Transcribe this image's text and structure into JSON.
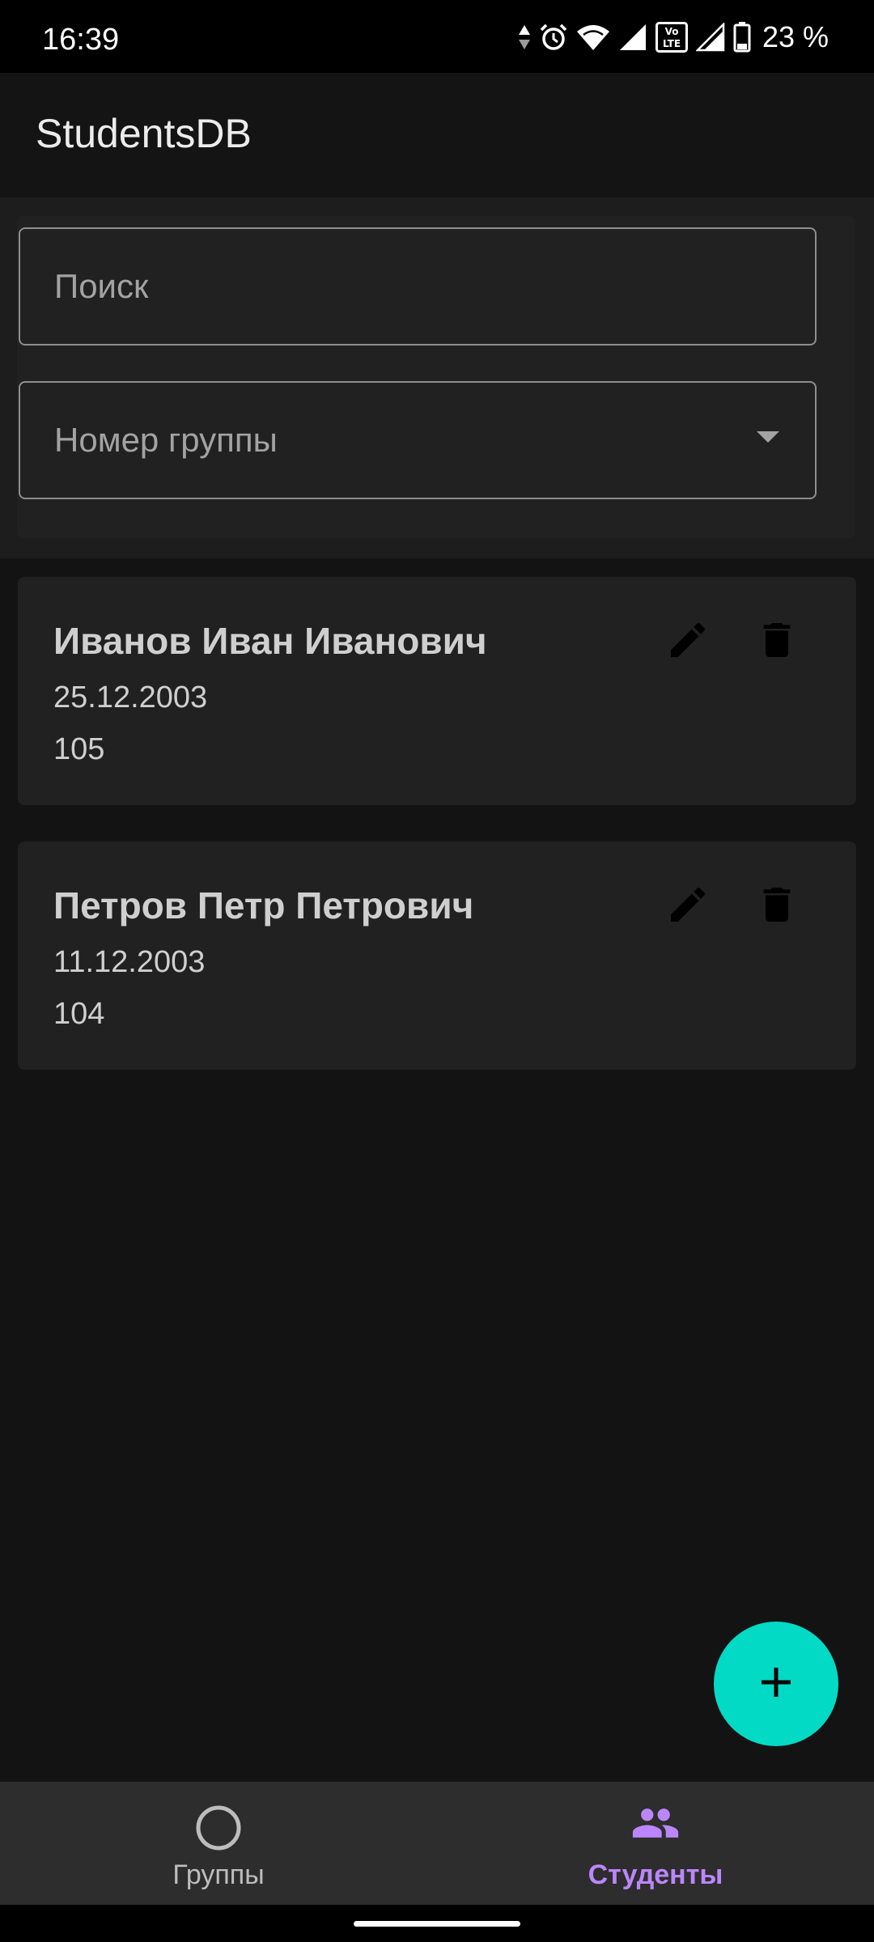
{
  "status_bar": {
    "time": "16:39",
    "battery": "23 %",
    "icons": [
      "data-arrows-icon",
      "alarm-icon",
      "wifi-icon",
      "volte-icon",
      "signal-icon",
      "battery-icon"
    ]
  },
  "app_bar": {
    "title": "StudentsDB"
  },
  "filters": {
    "search_placeholder": "Поиск",
    "group_label": "Номер группы",
    "group_icon": "dropdown-arrow-icon"
  },
  "students": [
    {
      "name": "Иванов Иван Иванович",
      "birth_date": "25.12.2003",
      "group": "105"
    },
    {
      "name": "Петров Петр Петрович",
      "birth_date": "11.12.2003",
      "group": "104"
    }
  ],
  "fab": {
    "icon": "add-icon",
    "color": "#03dac5"
  },
  "bottom_nav": {
    "items": [
      {
        "label": "Группы",
        "icon": "circle-icon",
        "active": false
      },
      {
        "label": "Студенты",
        "icon": "people-icon",
        "active": true
      }
    ],
    "active_color": "#bb86fc"
  }
}
